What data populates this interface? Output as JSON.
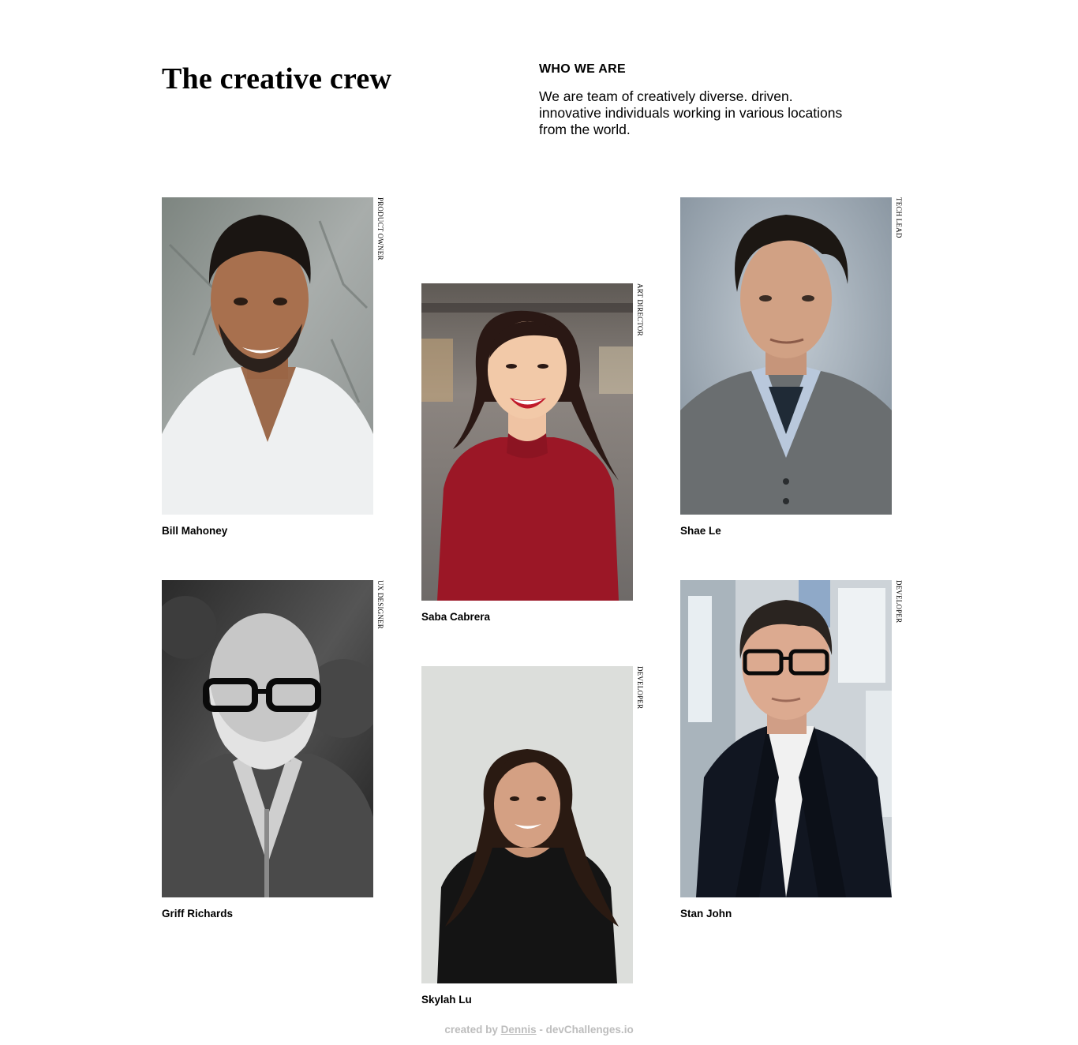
{
  "header": {
    "title": "The creative crew",
    "who_heading": "WHO WE ARE",
    "who_text": "We are team of creatively diverse. driven. innovative individuals working in various locations from the world."
  },
  "members": [
    {
      "name": "Bill Mahoney",
      "role": "PRODUCT OWNER"
    },
    {
      "name": "Saba Cabrera",
      "role": "ART DIRECTOR"
    },
    {
      "name": "Shae Le",
      "role": "TECH LEAD"
    },
    {
      "name": "Griff Richards",
      "role": "UX DESIGNER"
    },
    {
      "name": "Skylah Lu",
      "role": "DEVELOPER"
    },
    {
      "name": "Stan John",
      "role": "DEVELOPER"
    }
  ],
  "footer": {
    "prefix": "created by",
    "author": "Dennis",
    "suffix": "- devChallenges.io"
  },
  "colors": {
    "footer_text": "#bdbdbd",
    "text": "#000000"
  }
}
